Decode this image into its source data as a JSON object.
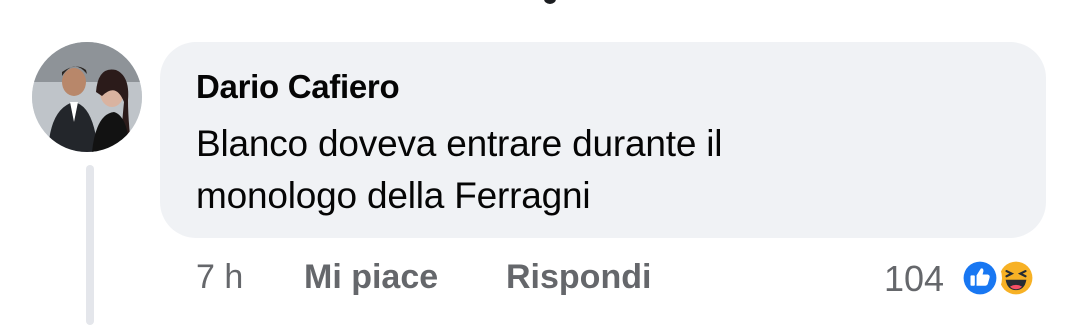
{
  "comment": {
    "author": "Dario Cafiero",
    "text_line1": "Blanco doveva entrare durante il",
    "text_line2": "monologo della Ferragni"
  },
  "actions": {
    "time": "7 h",
    "like_label": "Mi piace",
    "reply_label": "Rispondi"
  },
  "reactions": {
    "count": "104",
    "types": [
      "like-icon",
      "haha-icon"
    ]
  },
  "colors": {
    "bubble": "#f0f2f5",
    "secondary_text": "#65676b",
    "like_blue": "#1877f2",
    "haha_yellow": "#f7b125"
  }
}
